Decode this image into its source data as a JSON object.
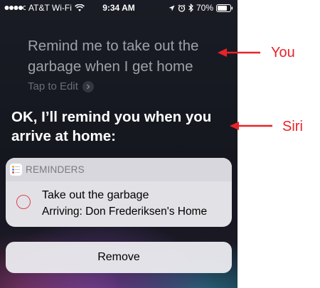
{
  "status_bar": {
    "carrier": "AT&T Wi-Fi",
    "time": "9:34 AM",
    "battery": "70%",
    "icons": [
      "signal-dots-icon",
      "wifi-icon",
      "location-arrow-icon",
      "alarm-icon",
      "bluetooth-icon",
      "battery-icon"
    ]
  },
  "user_query": "Remind me to take out the garbage when I get home",
  "tap_to_edit": "Tap to Edit",
  "siri_response": "OK, I’ll remind you when you arrive at home:",
  "reminder_card": {
    "header": "REMINDERS",
    "item": {
      "title": "Take out the garbage",
      "subtitle": "Arriving: Don Frederiksen's Home"
    }
  },
  "remove_button": "Remove",
  "annotations": {
    "you": "You",
    "siri": "Siri",
    "color": "#e8232a"
  }
}
